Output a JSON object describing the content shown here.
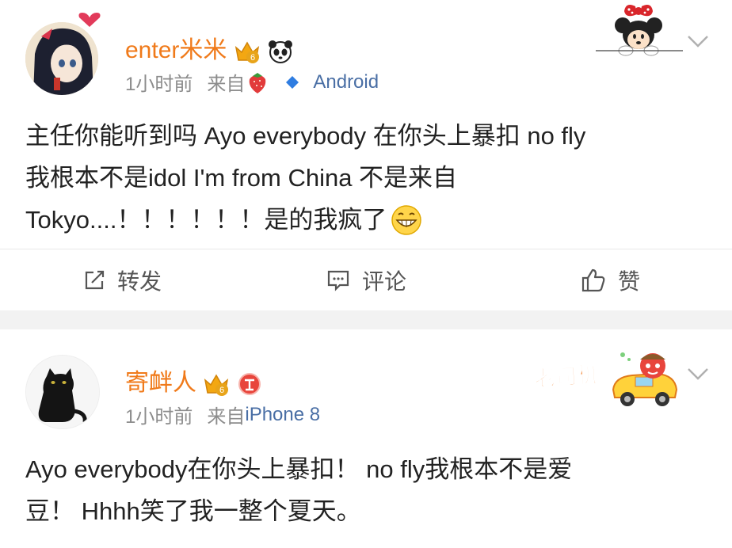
{
  "posts": [
    {
      "username": "enter米米",
      "time": "1小时前",
      "source_prefix": "来自",
      "source": "Android",
      "text_lines": [
        "主任你能听到吗 Ayo everybody 在你头上暴扣 no fly",
        "我根本不是idol I'm from China 不是来自",
        "Tokyo....！！！！！！是的我疯了"
      ],
      "actions": {
        "repost": "转发",
        "comment": "评论",
        "like": "赞"
      }
    },
    {
      "username": "寄衅人",
      "time": "1小时前",
      "source_prefix": "来自",
      "source": "iPhone 8",
      "sticker_text": "老司机",
      "text_lines": [
        "Ayo everybody在你头上暴扣！ no fly我根本不是爱",
        "豆！ Hhhh笑了我一整个夏天。"
      ]
    }
  ],
  "colors": {
    "username": "#f07a1a",
    "meta": "#8c8c8c",
    "link": "#4a6fa5",
    "divider": "#f2f2f2"
  }
}
